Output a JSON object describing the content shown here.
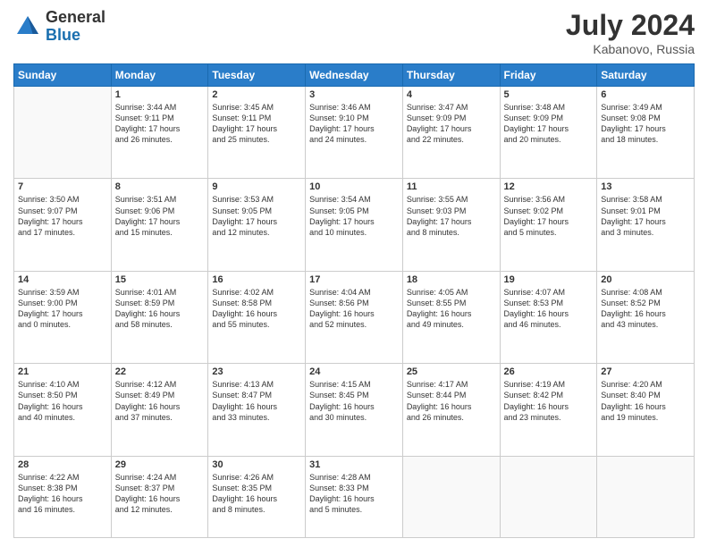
{
  "header": {
    "logo": {
      "general": "General",
      "blue": "Blue"
    },
    "title": "July 2024",
    "location": "Kabanovo, Russia"
  },
  "weekdays": [
    "Sunday",
    "Monday",
    "Tuesday",
    "Wednesday",
    "Thursday",
    "Friday",
    "Saturday"
  ],
  "weeks": [
    [
      {
        "day": "",
        "info": ""
      },
      {
        "day": "1",
        "info": "Sunrise: 3:44 AM\nSunset: 9:11 PM\nDaylight: 17 hours\nand 26 minutes."
      },
      {
        "day": "2",
        "info": "Sunrise: 3:45 AM\nSunset: 9:11 PM\nDaylight: 17 hours\nand 25 minutes."
      },
      {
        "day": "3",
        "info": "Sunrise: 3:46 AM\nSunset: 9:10 PM\nDaylight: 17 hours\nand 24 minutes."
      },
      {
        "day": "4",
        "info": "Sunrise: 3:47 AM\nSunset: 9:09 PM\nDaylight: 17 hours\nand 22 minutes."
      },
      {
        "day": "5",
        "info": "Sunrise: 3:48 AM\nSunset: 9:09 PM\nDaylight: 17 hours\nand 20 minutes."
      },
      {
        "day": "6",
        "info": "Sunrise: 3:49 AM\nSunset: 9:08 PM\nDaylight: 17 hours\nand 18 minutes."
      }
    ],
    [
      {
        "day": "7",
        "info": "Sunrise: 3:50 AM\nSunset: 9:07 PM\nDaylight: 17 hours\nand 17 minutes."
      },
      {
        "day": "8",
        "info": "Sunrise: 3:51 AM\nSunset: 9:06 PM\nDaylight: 17 hours\nand 15 minutes."
      },
      {
        "day": "9",
        "info": "Sunrise: 3:53 AM\nSunset: 9:05 PM\nDaylight: 17 hours\nand 12 minutes."
      },
      {
        "day": "10",
        "info": "Sunrise: 3:54 AM\nSunset: 9:05 PM\nDaylight: 17 hours\nand 10 minutes."
      },
      {
        "day": "11",
        "info": "Sunrise: 3:55 AM\nSunset: 9:03 PM\nDaylight: 17 hours\nand 8 minutes."
      },
      {
        "day": "12",
        "info": "Sunrise: 3:56 AM\nSunset: 9:02 PM\nDaylight: 17 hours\nand 5 minutes."
      },
      {
        "day": "13",
        "info": "Sunrise: 3:58 AM\nSunset: 9:01 PM\nDaylight: 17 hours\nand 3 minutes."
      }
    ],
    [
      {
        "day": "14",
        "info": "Sunrise: 3:59 AM\nSunset: 9:00 PM\nDaylight: 17 hours\nand 0 minutes."
      },
      {
        "day": "15",
        "info": "Sunrise: 4:01 AM\nSunset: 8:59 PM\nDaylight: 16 hours\nand 58 minutes."
      },
      {
        "day": "16",
        "info": "Sunrise: 4:02 AM\nSunset: 8:58 PM\nDaylight: 16 hours\nand 55 minutes."
      },
      {
        "day": "17",
        "info": "Sunrise: 4:04 AM\nSunset: 8:56 PM\nDaylight: 16 hours\nand 52 minutes."
      },
      {
        "day": "18",
        "info": "Sunrise: 4:05 AM\nSunset: 8:55 PM\nDaylight: 16 hours\nand 49 minutes."
      },
      {
        "day": "19",
        "info": "Sunrise: 4:07 AM\nSunset: 8:53 PM\nDaylight: 16 hours\nand 46 minutes."
      },
      {
        "day": "20",
        "info": "Sunrise: 4:08 AM\nSunset: 8:52 PM\nDaylight: 16 hours\nand 43 minutes."
      }
    ],
    [
      {
        "day": "21",
        "info": "Sunrise: 4:10 AM\nSunset: 8:50 PM\nDaylight: 16 hours\nand 40 minutes."
      },
      {
        "day": "22",
        "info": "Sunrise: 4:12 AM\nSunset: 8:49 PM\nDaylight: 16 hours\nand 37 minutes."
      },
      {
        "day": "23",
        "info": "Sunrise: 4:13 AM\nSunset: 8:47 PM\nDaylight: 16 hours\nand 33 minutes."
      },
      {
        "day": "24",
        "info": "Sunrise: 4:15 AM\nSunset: 8:45 PM\nDaylight: 16 hours\nand 30 minutes."
      },
      {
        "day": "25",
        "info": "Sunrise: 4:17 AM\nSunset: 8:44 PM\nDaylight: 16 hours\nand 26 minutes."
      },
      {
        "day": "26",
        "info": "Sunrise: 4:19 AM\nSunset: 8:42 PM\nDaylight: 16 hours\nand 23 minutes."
      },
      {
        "day": "27",
        "info": "Sunrise: 4:20 AM\nSunset: 8:40 PM\nDaylight: 16 hours\nand 19 minutes."
      }
    ],
    [
      {
        "day": "28",
        "info": "Sunrise: 4:22 AM\nSunset: 8:38 PM\nDaylight: 16 hours\nand 16 minutes."
      },
      {
        "day": "29",
        "info": "Sunrise: 4:24 AM\nSunset: 8:37 PM\nDaylight: 16 hours\nand 12 minutes."
      },
      {
        "day": "30",
        "info": "Sunrise: 4:26 AM\nSunset: 8:35 PM\nDaylight: 16 hours\nand 8 minutes."
      },
      {
        "day": "31",
        "info": "Sunrise: 4:28 AM\nSunset: 8:33 PM\nDaylight: 16 hours\nand 5 minutes."
      },
      {
        "day": "",
        "info": ""
      },
      {
        "day": "",
        "info": ""
      },
      {
        "day": "",
        "info": ""
      }
    ]
  ]
}
